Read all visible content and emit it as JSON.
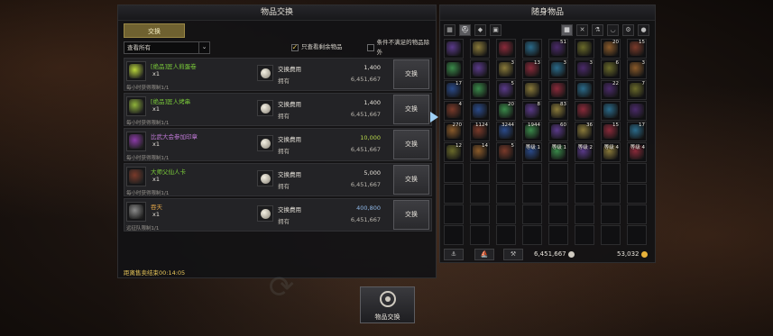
{
  "exchange_panel": {
    "title": "物品交换",
    "tab_label": "交换",
    "filter": {
      "dropdown_value": "查看所有",
      "show_remaining_label": "只查看剩余物品",
      "exclude_unmet_label": "条件不满足的物品除外"
    },
    "cost_label": "交换费用",
    "owned_label": "拥有",
    "exchange_button_label": "交换",
    "items": [
      {
        "name": "[绝品]匠人煎蛋卷",
        "name_color": "#7ccf3a",
        "qty": "x1",
        "limit": "每小时获得限制1/1",
        "cost": "1,400",
        "cost_color": "#e6e2da",
        "owned": "6,451,667",
        "icon": "omelet-icon",
        "icon_color": "#b9d53a"
      },
      {
        "name": "[绝品]匠人烤串",
        "name_color": "#7ccf3a",
        "qty": "x1",
        "limit": "每小时获得限制1/1",
        "cost": "1,400",
        "cost_color": "#e6e2da",
        "owned": "6,451,667",
        "icon": "skewer-icon",
        "icon_color": "#8fb33a"
      },
      {
        "name": "比武大会参加印章",
        "name_color": "#c27ad9",
        "qty": "x1",
        "limit": "每小时获得限制1/1",
        "cost": "10,000",
        "cost_color": "#b8d84a",
        "owned": "6,451,667",
        "icon": "stamp-icon",
        "icon_color": "#8b3aa8"
      },
      {
        "name": "大师父仙人卡",
        "name_color": "#7ccf3a",
        "qty": "x1",
        "limit": "每小时获得限制1/1",
        "cost": "5,000",
        "cost_color": "#e6e2da",
        "owned": "6,451,667",
        "icon": "card-icon",
        "icon_color": "#7a3a2a"
      },
      {
        "name": "吞天",
        "name_color": "#e0a448",
        "qty": "x1",
        "limit": "远征队限制1/1",
        "cost": "400,800",
        "cost_color": "#8fb8e8",
        "owned": "6,451,667",
        "icon": "scroll-icon",
        "icon_color": "#8a8a8a"
      }
    ],
    "sale_timer": "距离售卖结束00:14:05"
  },
  "inventory_panel": {
    "title": "随身物品",
    "tabs": [
      "grid",
      "helmet",
      "gem",
      "box",
      "grid",
      "swords",
      "potion",
      "bowl",
      "gear",
      "circle"
    ],
    "rows": [
      [
        "",
        "",
        "",
        "",
        "51",
        "",
        "20",
        "15"
      ],
      [
        "",
        "",
        "3",
        "13",
        "3",
        "3",
        "6",
        "3"
      ],
      [
        "17",
        "",
        "5",
        "",
        "",
        "",
        "22",
        "7"
      ],
      [
        "4",
        "",
        "20",
        "8",
        "83",
        "",
        "",
        ""
      ],
      [
        "270",
        "1124",
        "3244",
        "1944",
        "60",
        "36",
        "15",
        "17"
      ],
      [
        "12",
        "14",
        "5",
        "等级 1",
        "等级 1",
        "等级 2",
        "等级 4",
        "等级 4"
      ]
    ],
    "silver": "6,451,667",
    "gold": "53,032",
    "bottom_buttons": [
      "anchor",
      "ship",
      "tool"
    ]
  },
  "center_button": {
    "label": "物品交换"
  },
  "colors": {
    "accent_gold": "#e8c75a",
    "tab_active": "#6f6130"
  }
}
